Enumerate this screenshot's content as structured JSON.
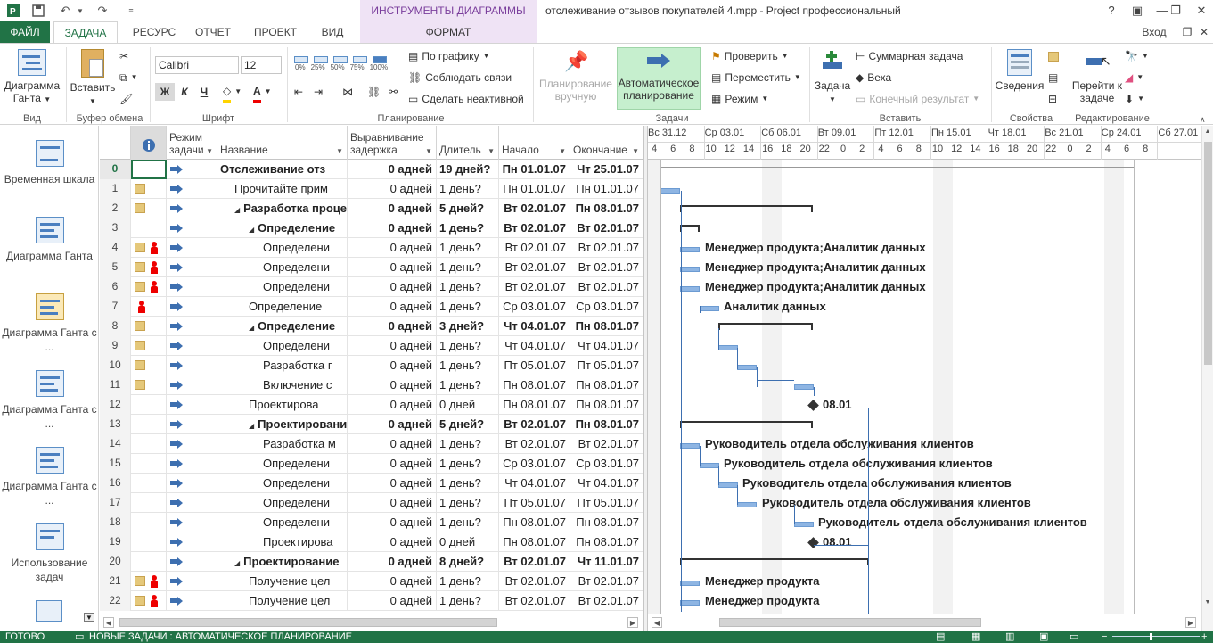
{
  "title_bar": {
    "context_tools": "ИНСТРУМЕНТЫ ДИАГРАММЫ ГАНТА",
    "doc_title": "отслеживание отзывов покупателей 4.mpp - Project профессиональный",
    "help": "?",
    "minimize": "—",
    "restore": "❐",
    "close": "✕"
  },
  "tabs": {
    "file": "ФАЙЛ",
    "task": "ЗАДАЧА",
    "resource": "РЕСУРС",
    "report": "ОТЧЕТ",
    "project": "ПРОЕКТ",
    "view": "ВИД",
    "format": "ФОРМАТ",
    "login": "Вход"
  },
  "ribbon": {
    "view_group": {
      "gantt_btn": "Диаграмма Ганта",
      "label": "Вид"
    },
    "clipboard": {
      "paste": "Вставить",
      "label": "Буфер обмена"
    },
    "font": {
      "family": "Calibri",
      "size": "12",
      "bold": "Ж",
      "italic": "К",
      "underline": "Ч",
      "label": "Шрифт"
    },
    "schedule": {
      "pct": [
        "0%",
        "25%",
        "50%",
        "75%",
        "100%"
      ],
      "on_track": "По графику",
      "respect_links": "Соблюдать связи",
      "inactivate": "Сделать неактивной",
      "label": "Планирование"
    },
    "tasks": {
      "manual": "Планирование вручную",
      "auto": "Автоматическое планирование",
      "inspect": "Проверить",
      "move": "Переместить",
      "mode": "Режим",
      "label": "Задачи"
    },
    "insert": {
      "task": "Задача",
      "summary": "Суммарная задача",
      "milestone": "Веха",
      "deliverable": "Конечный результат",
      "label": "Вставить"
    },
    "properties": {
      "info": "Сведения",
      "label": "Свойства"
    },
    "editing": {
      "goto": "Перейти к задаче",
      "label": "Редактирование"
    }
  },
  "views": [
    {
      "label": "Временная шкала"
    },
    {
      "label": "Диаграмма Ганта"
    },
    {
      "label": "Диаграмма Ганта с ..."
    },
    {
      "label": "Диаграмма Ганта с ..."
    },
    {
      "label": "Диаграмма Ганта с ..."
    },
    {
      "label": "Использование задач"
    }
  ],
  "columns": {
    "mode": "Режим задачи",
    "name": "Название",
    "leveling": "Выравнивание задержка",
    "duration": "Длитель",
    "start": "Начало",
    "finish": "Окончание"
  },
  "rows": [
    {
      "id": "0",
      "name": "Отслеживание отз",
      "lev": "0 адней",
      "dur": "19 дней?",
      "start": "Пн 01.01.07",
      "fin": "Чт 25.01.07",
      "bold": true,
      "level": 0,
      "summary": true,
      "note": false,
      "person": false
    },
    {
      "id": "1",
      "name": "Прочитайте прим",
      "lev": "0 адней",
      "dur": "1 день?",
      "start": "Пн 01.01.07",
      "fin": "Пн 01.01.07",
      "bold": false,
      "level": 1,
      "summary": false,
      "note": true,
      "person": false
    },
    {
      "id": "2",
      "name": "Разработка проце",
      "lev": "0 адней",
      "dur": "5 дней?",
      "start": "Вт 02.01.07",
      "fin": "Пн 08.01.07",
      "bold": true,
      "level": 1,
      "summary": true,
      "note": true,
      "person": false
    },
    {
      "id": "3",
      "name": "Определение",
      "lev": "0 адней",
      "dur": "1 день?",
      "start": "Вт 02.01.07",
      "fin": "Вт 02.01.07",
      "bold": true,
      "level": 2,
      "summary": true,
      "note": false,
      "person": false
    },
    {
      "id": "4",
      "name": "Определени",
      "lev": "0 адней",
      "dur": "1 день?",
      "start": "Вт 02.01.07",
      "fin": "Вт 02.01.07",
      "bold": false,
      "level": 3,
      "summary": false,
      "note": true,
      "person": true
    },
    {
      "id": "5",
      "name": "Определени",
      "lev": "0 адней",
      "dur": "1 день?",
      "start": "Вт 02.01.07",
      "fin": "Вт 02.01.07",
      "bold": false,
      "level": 3,
      "summary": false,
      "note": true,
      "person": true
    },
    {
      "id": "6",
      "name": "Определени",
      "lev": "0 адней",
      "dur": "1 день?",
      "start": "Вт 02.01.07",
      "fin": "Вт 02.01.07",
      "bold": false,
      "level": 3,
      "summary": false,
      "note": true,
      "person": true
    },
    {
      "id": "7",
      "name": "Определение",
      "lev": "0 адней",
      "dur": "1 день?",
      "start": "Ср 03.01.07",
      "fin": "Ср 03.01.07",
      "bold": false,
      "level": 2,
      "summary": false,
      "note": false,
      "person": true
    },
    {
      "id": "8",
      "name": "Определение",
      "lev": "0 адней",
      "dur": "3 дней?",
      "start": "Чт 04.01.07",
      "fin": "Пн 08.01.07",
      "bold": true,
      "level": 2,
      "summary": true,
      "note": true,
      "person": false
    },
    {
      "id": "9",
      "name": "Определени",
      "lev": "0 адней",
      "dur": "1 день?",
      "start": "Чт 04.01.07",
      "fin": "Чт 04.01.07",
      "bold": false,
      "level": 3,
      "summary": false,
      "note": true,
      "person": false
    },
    {
      "id": "10",
      "name": "Разработка г",
      "lev": "0 адней",
      "dur": "1 день?",
      "start": "Пт 05.01.07",
      "fin": "Пт 05.01.07",
      "bold": false,
      "level": 3,
      "summary": false,
      "note": true,
      "person": false
    },
    {
      "id": "11",
      "name": "Включение с",
      "lev": "0 адней",
      "dur": "1 день?",
      "start": "Пн 08.01.07",
      "fin": "Пн 08.01.07",
      "bold": false,
      "level": 3,
      "summary": false,
      "note": true,
      "person": false
    },
    {
      "id": "12",
      "name": "Проектирова",
      "lev": "0 адней",
      "dur": "0 дней",
      "start": "Пн 08.01.07",
      "fin": "Пн 08.01.07",
      "bold": false,
      "level": 2,
      "summary": false,
      "note": false,
      "person": false
    },
    {
      "id": "13",
      "name": "Проектировани",
      "lev": "0 адней",
      "dur": "5 дней?",
      "start": "Вт 02.01.07",
      "fin": "Пн 08.01.07",
      "bold": true,
      "level": 2,
      "summary": true,
      "note": false,
      "person": false
    },
    {
      "id": "14",
      "name": "Разработка м",
      "lev": "0 адней",
      "dur": "1 день?",
      "start": "Вт 02.01.07",
      "fin": "Вт 02.01.07",
      "bold": false,
      "level": 3,
      "summary": false,
      "note": false,
      "person": false
    },
    {
      "id": "15",
      "name": "Определени",
      "lev": "0 адней",
      "dur": "1 день?",
      "start": "Ср 03.01.07",
      "fin": "Ср 03.01.07",
      "bold": false,
      "level": 3,
      "summary": false,
      "note": false,
      "person": false
    },
    {
      "id": "16",
      "name": "Определени",
      "lev": "0 адней",
      "dur": "1 день?",
      "start": "Чт 04.01.07",
      "fin": "Чт 04.01.07",
      "bold": false,
      "level": 3,
      "summary": false,
      "note": false,
      "person": false
    },
    {
      "id": "17",
      "name": "Определени",
      "lev": "0 адней",
      "dur": "1 день?",
      "start": "Пт 05.01.07",
      "fin": "Пт 05.01.07",
      "bold": false,
      "level": 3,
      "summary": false,
      "note": false,
      "person": false
    },
    {
      "id": "18",
      "name": "Определени",
      "lev": "0 адней",
      "dur": "1 день?",
      "start": "Пн 08.01.07",
      "fin": "Пн 08.01.07",
      "bold": false,
      "level": 3,
      "summary": false,
      "note": false,
      "person": false
    },
    {
      "id": "19",
      "name": "Проектирова",
      "lev": "0 адней",
      "dur": "0 дней",
      "start": "Пн 08.01.07",
      "fin": "Пн 08.01.07",
      "bold": false,
      "level": 3,
      "summary": false,
      "note": false,
      "person": false
    },
    {
      "id": "20",
      "name": "Проектирование",
      "lev": "0 адней",
      "dur": "8 дней?",
      "start": "Вт 02.01.07",
      "fin": "Чт 11.01.07",
      "bold": true,
      "level": 1,
      "summary": true,
      "note": false,
      "person": false
    },
    {
      "id": "21",
      "name": "Получение цел",
      "lev": "0 адней",
      "dur": "1 день?",
      "start": "Вт 02.01.07",
      "fin": "Вт 02.01.07",
      "bold": false,
      "level": 2,
      "summary": false,
      "note": true,
      "person": true
    },
    {
      "id": "22",
      "name": "Получение цел",
      "lev": "0 адней",
      "dur": "1 день?",
      "start": "Вт 02.01.07",
      "fin": "Вт 02.01.07",
      "bold": false,
      "level": 2,
      "summary": false,
      "note": true,
      "person": true
    }
  ],
  "timescale": {
    "major": [
      "Вс 31.12",
      "Ср 03.01",
      "Сб 06.01",
      "Вт 09.01",
      "Пт 12.01",
      "Пн 15.01",
      "Чт 18.01",
      "Вс 21.01",
      "Ср 24.01",
      "Сб 27.01"
    ],
    "minor": [
      "4",
      "6",
      "8",
      "10",
      "12",
      "14",
      "16",
      "18",
      "20",
      "22",
      "0",
      "2",
      "4",
      "6",
      "8",
      "10",
      "12",
      "14",
      "16",
      "18",
      "20",
      "22",
      "0",
      "2",
      "4",
      "6",
      "8"
    ]
  },
  "gantt_labels": {
    "r4": "Менеджер продукта;Аналитик данных",
    "r5": "Менеджер продукта;Аналитик данных",
    "r6": "Менеджер продукта;Аналитик данных",
    "r7": "Аналитик данных",
    "r12": "08.01",
    "r14": "Руководитель отдела обслуживания клиентов",
    "r15": "Руководитель отдела обслуживания клиентов",
    "r16": "Руководитель отдела обслуживания клиентов",
    "r17": "Руководитель отдела обслуживания клиентов",
    "r18": "Руководитель отдела обслуживания клиентов",
    "r19": "08.01",
    "r21": "Менеджер продукта",
    "r22": "Менеджер продукта"
  },
  "status": {
    "ready": "ГОТОВО",
    "new_tasks": "НОВЫЕ ЗАДАЧИ : АВТОМАТИЧЕСКОЕ ПЛАНИРОВАНИЕ"
  },
  "colors": {
    "accent": "#217346",
    "context": "#7a3e9c",
    "bar": "#8eb5e3",
    "link": "#3d6fb0"
  }
}
